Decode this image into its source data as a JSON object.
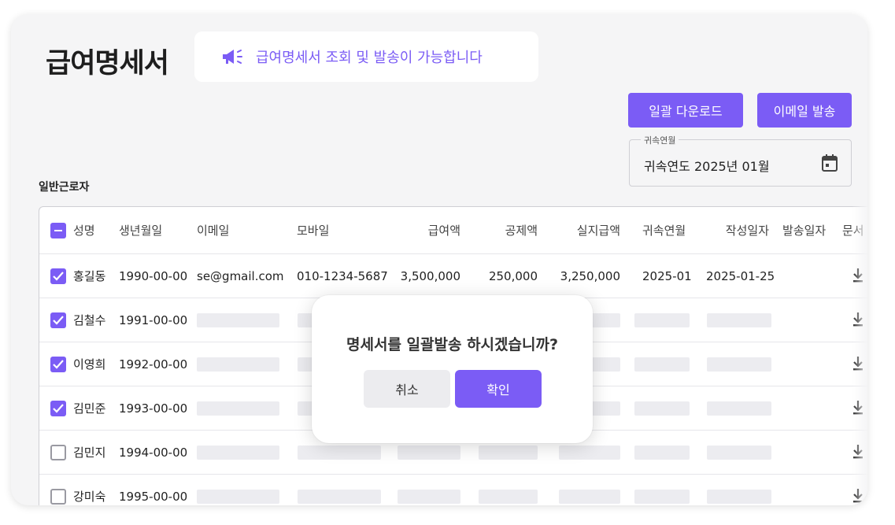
{
  "page": {
    "title": "급여명세서"
  },
  "notice": {
    "text": "급여명세서 조회 및 발송이 가능합니다",
    "icon": "megaphone-icon"
  },
  "toolbar": {
    "bulk_download_label": "일괄 다운로드",
    "email_send_label": "이메일 발송"
  },
  "period": {
    "label": "귀속연월",
    "value": "귀속연도 2025년 01월",
    "icon": "calendar-icon"
  },
  "section": {
    "label": "일반근로자"
  },
  "table": {
    "headers": [
      "성명",
      "생년월일",
      "이메일",
      "모바일",
      "급여액",
      "공제액",
      "실지급액",
      "귀속연월",
      "작성일자",
      "발송일자",
      "문서"
    ],
    "rows": [
      {
        "checked": true,
        "name": "홍길동",
        "birth": "1990-00-00",
        "email": "se@gmail.com",
        "mobile": "010-1234-5687",
        "pay": "3,500,000",
        "deduction": "250,000",
        "net": "3,250,000",
        "period": "2025-01",
        "written": "2025-01-25",
        "sent": ""
      },
      {
        "checked": true,
        "name": "김철수",
        "birth": "1991-00-00"
      },
      {
        "checked": true,
        "name": "이영희",
        "birth": "1992-00-00"
      },
      {
        "checked": true,
        "name": "김민준",
        "birth": "1993-00-00"
      },
      {
        "checked": false,
        "name": "김민지",
        "birth": "1994-00-00"
      },
      {
        "checked": false,
        "name": "강미숙",
        "birth": "1995-00-00"
      }
    ]
  },
  "modal": {
    "message": "명세서를 일괄발송 하시겠습니까?",
    "cancel_label": "취소",
    "confirm_label": "확인"
  },
  "colors": {
    "accent": "#7b5cf5",
    "background": "#f5f5f6",
    "placeholder": "#ececf0"
  }
}
